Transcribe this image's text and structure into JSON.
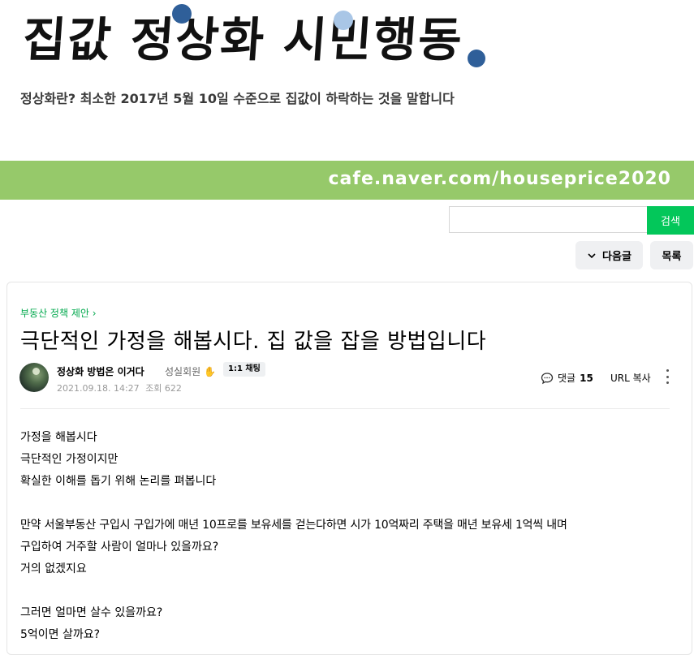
{
  "banner": {
    "title": "집값 정상화 시민행동",
    "subtitle": "정상화란? 최소한 2017년 5월 10일 수준으로 집값이 하락하는 것을 말합니다",
    "cafe_url": "cafe.naver.com/houseprice2020"
  },
  "search": {
    "placeholder": "",
    "value": "",
    "button_label": "검색"
  },
  "nav": {
    "next_label": "다음글",
    "list_label": "목록"
  },
  "post": {
    "category": "부동산 정책 제안",
    "title": "극단적인 가정을 해봅시다. 집 값을 잡을 방법입니다",
    "author": "정상화 방법은 이거다",
    "grade": "성실회원",
    "chat_badge": "1:1 채팅",
    "date": "2021.09.18. 14:27",
    "views_label": "조회 622",
    "comments_label": "댓글",
    "comments_count": "15",
    "url_copy": "URL 복사",
    "body": [
      "가정을 해봅시다",
      "극단적인 가정이지만",
      "확실한 이해를 돕기 위해 논리를 펴봅니다",
      "",
      "만약 서울부동산 구입시 구입가에 매년 10프로를 보유세를 걷는다하면 시가 10억짜리 주택을 매년 보유세 1억씩 내며",
      "구입하여 거주할 사람이 얼마나 있을까요?",
      "거의 없겠지요",
      "",
      "그러면 얼마면 살수 있을까요?",
      "5억이면 살까요?"
    ]
  },
  "colors": {
    "accent_green": "#03c75a",
    "banner_green": "#96c96a",
    "category_green": "#03a94e"
  }
}
